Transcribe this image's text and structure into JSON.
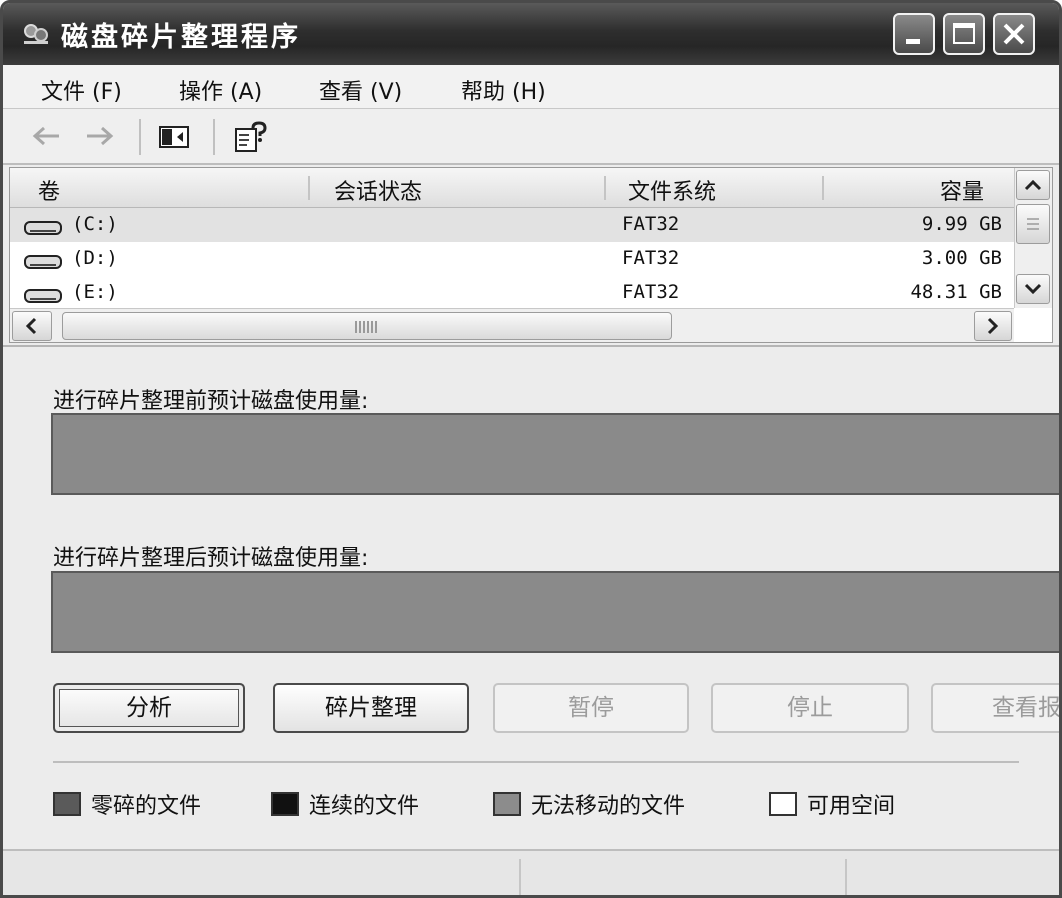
{
  "window": {
    "title": "磁盘碎片整理程序"
  },
  "menu": [
    {
      "label": "文件 (F)"
    },
    {
      "label": "操作 (A)"
    },
    {
      "label": "查看 (V)"
    },
    {
      "label": "帮助 (H)"
    }
  ],
  "toolbar": {
    "icons": [
      "back-arrow-icon",
      "forward-arrow-icon",
      "show-hide-pane-icon",
      "help-properties-icon"
    ]
  },
  "volumes": {
    "columns": [
      "卷",
      "会话状态",
      "文件系统",
      "容量"
    ],
    "rows": [
      {
        "volume": "(C:)",
        "status": "",
        "fs": "FAT32",
        "capacity": "9.99 GB"
      },
      {
        "volume": "(D:)",
        "status": "",
        "fs": "FAT32",
        "capacity": "3.00 GB"
      },
      {
        "volume": "(E:)",
        "status": "",
        "fs": "FAT32",
        "capacity": "48.31 GB"
      }
    ]
  },
  "usage": {
    "before_label": "进行碎片整理前预计磁盘使用量:",
    "after_label": "进行碎片整理后预计磁盘使用量:"
  },
  "buttons": {
    "analyze": "分析",
    "defragment": "碎片整理",
    "pause": "暂停",
    "stop": "停止",
    "view_report": "查看报"
  },
  "legend": [
    {
      "label": "零碎的文件",
      "color": "#5a5a5a"
    },
    {
      "label": "连续的文件",
      "color": "#111111"
    },
    {
      "label": "无法移动的文件",
      "color": "#8c8c8c"
    },
    {
      "label": "可用空间",
      "color": "#ffffff"
    }
  ],
  "colors": {
    "title_bar": "#2e2e2e",
    "usage_bar": "#8a8a8a",
    "selected_row": "#e2e2e2"
  }
}
